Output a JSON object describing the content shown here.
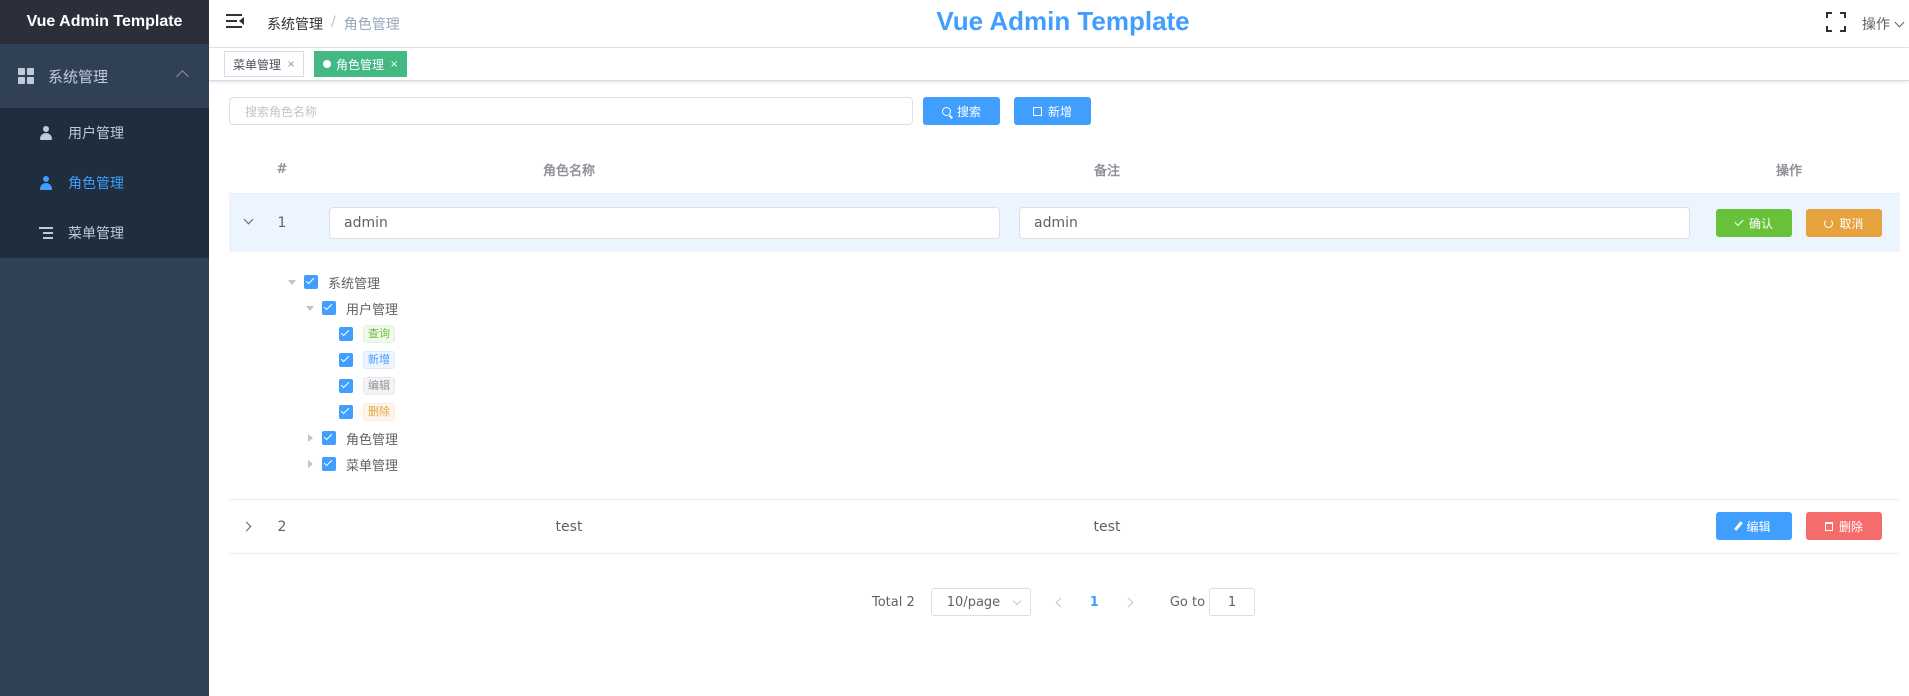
{
  "app": {
    "logo": "Vue Admin Template",
    "title": "Vue Admin Template"
  },
  "sidebar": {
    "parent": "系统管理",
    "items": [
      {
        "label": "用户管理"
      },
      {
        "label": "角色管理"
      },
      {
        "label": "菜单管理"
      }
    ]
  },
  "navbar": {
    "breadcrumb": [
      "系统管理",
      "角色管理"
    ],
    "separator": "/",
    "ops_label": "操作"
  },
  "tags": [
    {
      "label": "菜单管理",
      "close": "×"
    },
    {
      "label": "角色管理",
      "close": "×"
    }
  ],
  "toolbar": {
    "search_placeholder": "搜索角色名称",
    "search_label": "搜索",
    "add_label": "新增"
  },
  "table": {
    "headers": [
      "#",
      "角色名称",
      "备注",
      "操作"
    ],
    "rows": [
      {
        "index": "1",
        "name": "admin",
        "remark": "admin",
        "actions": [
          "确认",
          "取消"
        ]
      },
      {
        "index": "2",
        "name": "test",
        "remark": "test",
        "actions": [
          "编辑",
          "删除"
        ]
      }
    ]
  },
  "tree": {
    "root": "系统管理",
    "user_mgmt": "用户管理",
    "perms": [
      "查询",
      "新增",
      "编辑",
      "删除"
    ],
    "role_mgmt": "角色管理",
    "menu_mgmt": "菜单管理"
  },
  "pagination": {
    "total": "Total 2",
    "page_size": "10/page",
    "current": "1",
    "goto_label": "Go to",
    "goto_value": "1"
  },
  "colors": {
    "primary": "#409eff",
    "success": "#67c23a",
    "warning": "#e6a23c",
    "danger": "#f56c6c",
    "tag_active": "#42b983",
    "sidebar_bg": "#304156"
  }
}
